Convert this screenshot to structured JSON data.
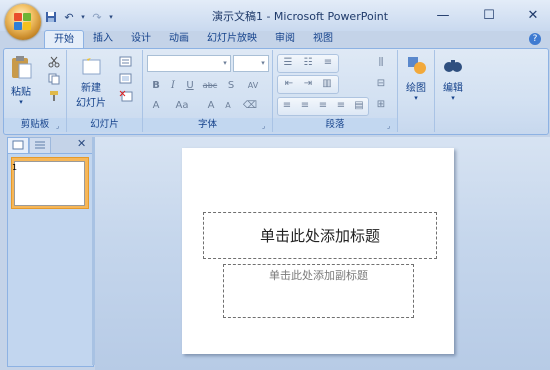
{
  "window": {
    "title": "演示文稿1 - Microsoft PowerPoint"
  },
  "qat": {
    "save": "save-icon",
    "undo": "undo-icon",
    "redo": "redo-icon",
    "more": "▾"
  },
  "tabs": [
    {
      "label": "开始",
      "active": true
    },
    {
      "label": "插入"
    },
    {
      "label": "设计"
    },
    {
      "label": "动画"
    },
    {
      "label": "幻灯片放映"
    },
    {
      "label": "审阅"
    },
    {
      "label": "视图"
    }
  ],
  "ribbon": {
    "clipboard": {
      "paste": "粘贴",
      "label": "剪贴板"
    },
    "slides": {
      "new_slide_1": "新建",
      "new_slide_2": "幻灯片",
      "label": "幻灯片"
    },
    "font": {
      "label": "字体",
      "bold": "B",
      "italic": "I",
      "underline": "U",
      "strike": "abc",
      "shadow": "S",
      "spacing": "AV",
      "font_color": "A",
      "change_case": "Aa",
      "grow": "A",
      "shrink": "A"
    },
    "paragraph": {
      "label": "段落"
    },
    "drawing": {
      "label": "绘图"
    },
    "editing": {
      "label": "编辑"
    }
  },
  "slide": {
    "title_placeholder": "单击此处添加标题",
    "subtitle_placeholder": "单击此处添加副标题"
  },
  "thumbnail": {
    "number": "1"
  },
  "colors": {
    "ribbon": "#dfe9f5",
    "accent": "#15428b",
    "thumb_selected": "#f7b758"
  }
}
